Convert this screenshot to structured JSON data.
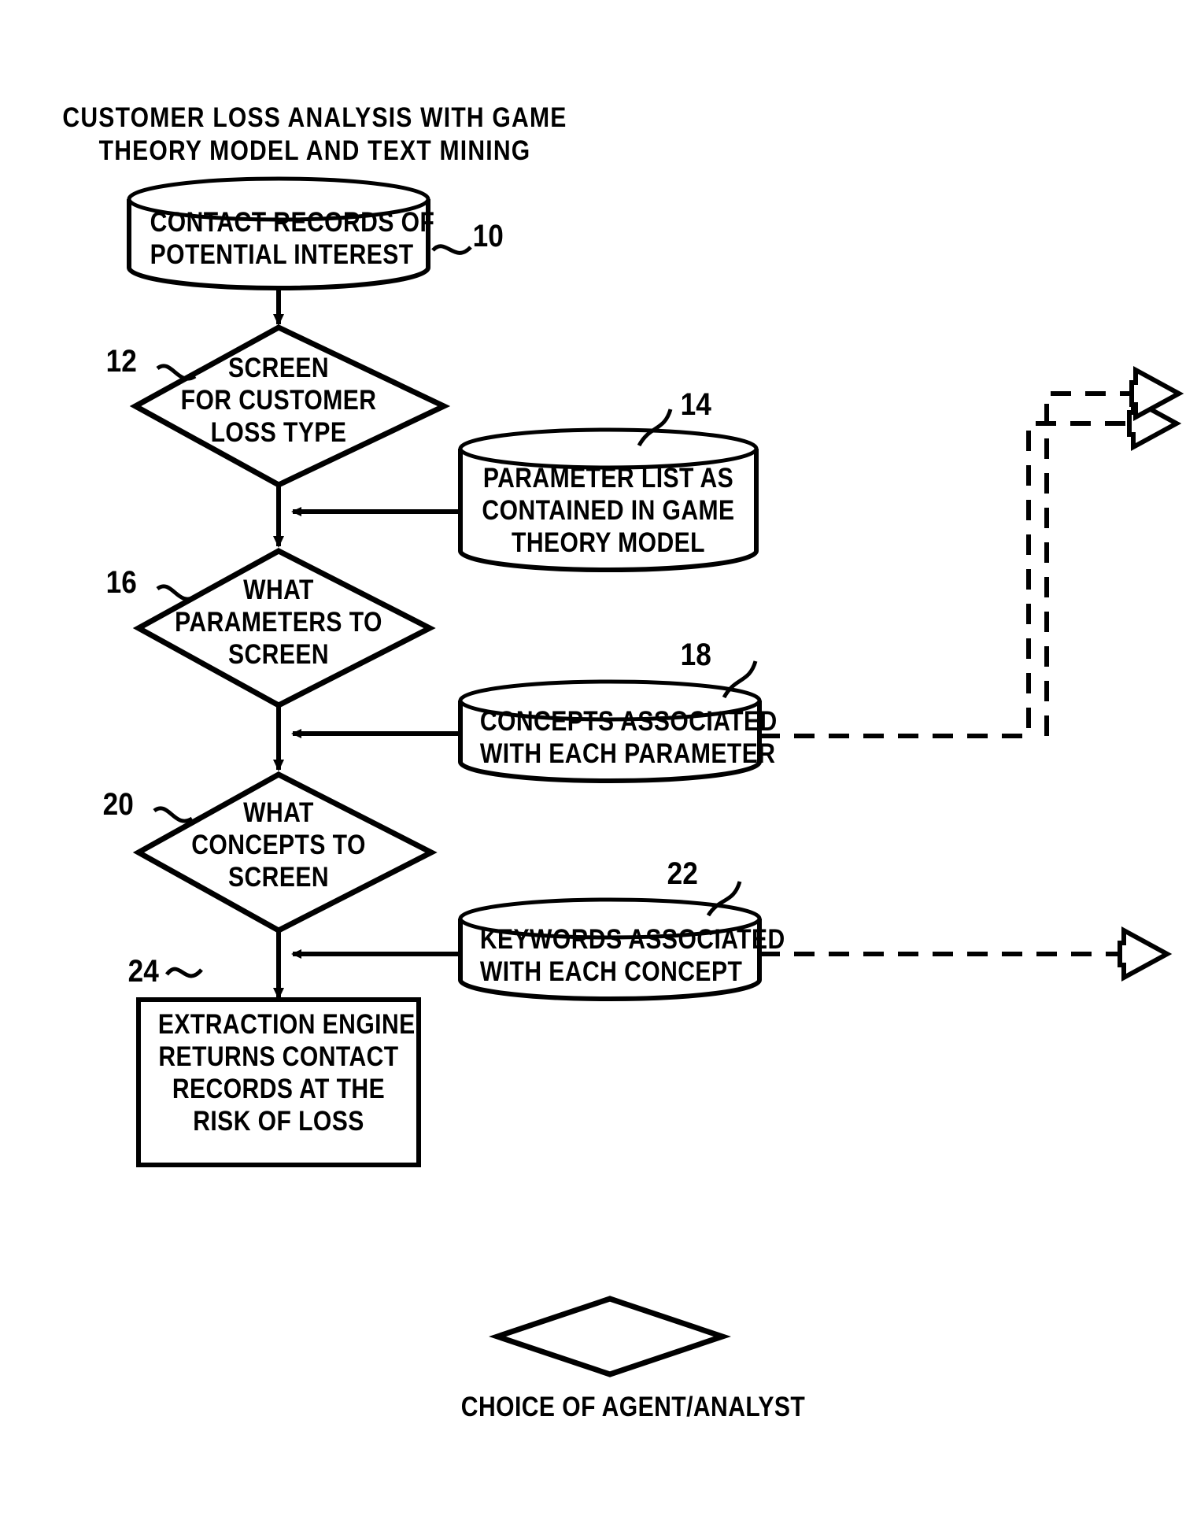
{
  "figure": {
    "title": "CUSTOMER LOSS ANALYSIS WITH\nTHEORY MODEL AND TEXT MINING",
    "title_line1": "CUSTOMER LOSS ANALYSIS WITH GAME",
    "title_line2": "THEORY MODEL AND TEXT MINING"
  },
  "nodes": {
    "contact_records": {
      "ref": "10",
      "type": "cylinder",
      "line1": "CONTACT RECORDS OF",
      "line2": "POTENTIAL INTEREST"
    },
    "screen_loss_type": {
      "ref": "12",
      "type": "decision",
      "line1": "SCREEN",
      "line2": "FOR CUSTOMER",
      "line3": "LOSS TYPE"
    },
    "parameter_list": {
      "ref": "14",
      "type": "cylinder",
      "line1": "PARAMETER LIST AS",
      "line2": "CONTAINED IN GAME",
      "line3": "THEORY MODEL"
    },
    "what_parameters": {
      "ref": "16",
      "type": "decision",
      "line1": "WHAT",
      "line2": "PARAMETERS TO",
      "line3": "SCREEN"
    },
    "concepts_associated": {
      "ref": "18",
      "type": "cylinder",
      "line1": "CONCEPTS ASSOCIATED",
      "line2": "WITH EACH PARAMETER"
    },
    "what_concepts": {
      "ref": "20",
      "type": "decision",
      "line1": "WHAT",
      "line2": "CONCEPTS TO",
      "line3": "SCREEN"
    },
    "keywords_associated": {
      "ref": "22",
      "type": "cylinder",
      "line1": "KEYWORDS ASSOCIATED",
      "line2": "WITH EACH CONCEPT"
    },
    "extraction_engine": {
      "ref": "24",
      "type": "process",
      "line1": "EXTRACTION ENGINE",
      "line2": "RETURNS CONTACT",
      "line3": "RECORDS AT THE",
      "line4": "RISK OF LOSS"
    }
  },
  "legend": {
    "diamond_label": "CHOICE OF AGENT/ANALYST"
  },
  "style": {
    "stroke": "#000000",
    "fill": "#ffffff",
    "background": "#ffffff"
  }
}
